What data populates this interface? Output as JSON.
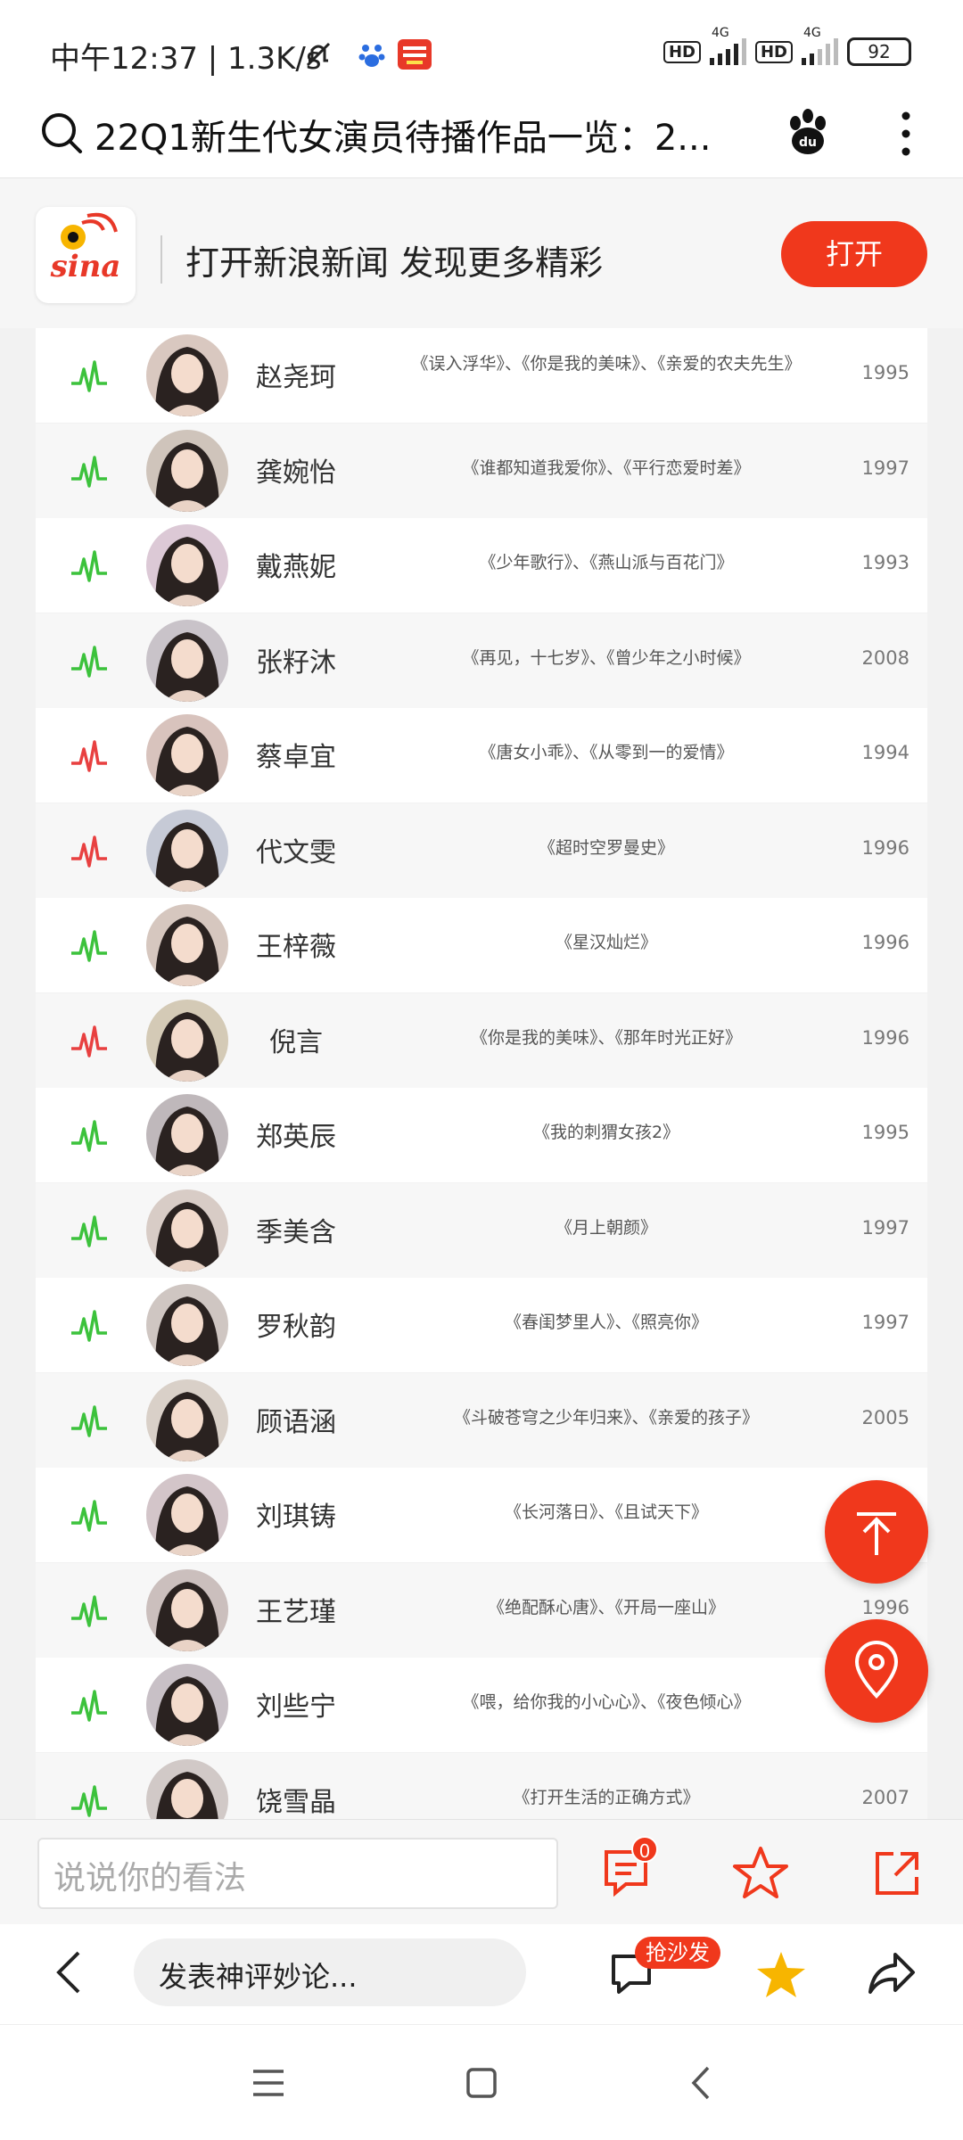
{
  "status_bar": {
    "time": "中午12:37 | 1.3K/s",
    "hd1": "HD",
    "net1": "4G",
    "hd2": "HD",
    "net2": "4G",
    "battery": "92"
  },
  "search": {
    "title": "22Q1新生代女演员待播作品一览：2..."
  },
  "banner": {
    "brand": "sina",
    "text": "打开新浪新闻 发现更多精彩",
    "open_label": "打开"
  },
  "table": {
    "rows": [
      {
        "name": "赵尧珂",
        "works": "《误入浮华》、《你是我的美味》、《亲爱的农夫先生》",
        "year": "1995",
        "trend": "green"
      },
      {
        "name": "龚婉怡",
        "works": "《谁都知道我爱你》、《平行恋爱时差》",
        "year": "1997",
        "trend": "green"
      },
      {
        "name": "戴燕妮",
        "works": "《少年歌行》、《燕山派与百花门》",
        "year": "1993",
        "trend": "green"
      },
      {
        "name": "张籽沐",
        "works": "《再见，十七岁》、《曾少年之小时候》",
        "year": "2008",
        "trend": "green"
      },
      {
        "name": "蔡卓宜",
        "works": "《唐女小乖》、《从零到一的爱情》",
        "year": "1994",
        "trend": "red"
      },
      {
        "name": "代文雯",
        "works": "《超时空罗曼史》",
        "year": "1996",
        "trend": "red"
      },
      {
        "name": "王梓薇",
        "works": "《星汉灿烂》",
        "year": "1996",
        "trend": "green"
      },
      {
        "name": "倪言",
        "works": "《你是我的美味》、《那年时光正好》",
        "year": "1996",
        "trend": "red"
      },
      {
        "name": "郑英辰",
        "works": "《我的刺猬女孩2》",
        "year": "1995",
        "trend": "green"
      },
      {
        "name": "季美含",
        "works": "《月上朝颜》",
        "year": "1997",
        "trend": "green"
      },
      {
        "name": "罗秋韵",
        "works": "《春闺梦里人》、《照亮你》",
        "year": "1997",
        "trend": "green"
      },
      {
        "name": "顾语涵",
        "works": "《斗破苍穹之少年归来》、《亲爱的孩子》",
        "year": "2005",
        "trend": "green"
      },
      {
        "name": "刘琪铸",
        "works": "《长河落日》、《且试天下》",
        "year": "",
        "trend": "green"
      },
      {
        "name": "王艺瑾",
        "works": "《绝配酥心唐》、《开局一座山》",
        "year": "1996",
        "trend": "green"
      },
      {
        "name": "刘些宁",
        "works": "《喂，给你我的小心心》、《夜色倾心》",
        "year": "",
        "trend": "green"
      },
      {
        "name": "饶雪晶",
        "works": "《打开生活的正确方式》",
        "year": "2007",
        "trend": "green"
      }
    ]
  },
  "comment_bar": {
    "placeholder": "说说你的看法",
    "comment_count": "0"
  },
  "bottom_bar": {
    "compose_placeholder": "发表神评妙论...",
    "sofa_badge": "抢沙发"
  },
  "colors": {
    "accent": "#f0381c",
    "trend_green": "#3cc23c",
    "trend_red": "#e84040",
    "star": "#f7b500"
  }
}
